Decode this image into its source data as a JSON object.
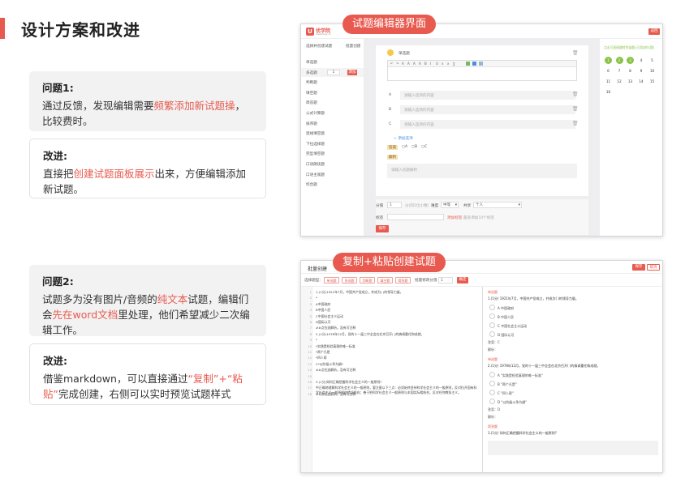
{
  "page": {
    "title": "设计方案和改进"
  },
  "problem1": {
    "heading": "问题1:",
    "text_a": "通过反馈，发现编辑需要",
    "text_hl": "频繁添加新试题操",
    "text_b": "，比较费时。"
  },
  "improve1": {
    "heading": "改进:",
    "text_a": "直接把",
    "text_hl": "创建试题面板展示",
    "text_b": "出来，方便编辑添加新试题。"
  },
  "problem2": {
    "heading": "问题2:",
    "text_a": "试题多为没有图片/音频的",
    "text_hl1": "纯文本",
    "text_b": "试题，编辑们会",
    "text_hl2": "先在word文档",
    "text_c": "里处理，他们希望减少二次编辑工作。"
  },
  "improve2": {
    "heading": "改进:",
    "text_a": "借鉴markdown，可以直接通过",
    "text_hl": "“复制”+“粘贴”",
    "text_b": "完成创建，右侧可以实时预览试题样式"
  },
  "shot1": {
    "label": "试题编辑器界面",
    "logo": "优学院",
    "logo_sub": "ulearning.cn",
    "top_btn": "返回",
    "left_header_a": "选择并创建试题",
    "left_header_b": "批量创建",
    "types": [
      "单选题",
      "多选题",
      "判断题",
      "填空题",
      "简答题",
      "公式计算题",
      "排序题",
      "连线填空题",
      "下拉选择题",
      "完型填空题",
      "口语朗读题",
      "口语主观题",
      "综合题"
    ],
    "type_count": "1",
    "type_add": "添加",
    "q_type": "单选题",
    "toolbar": [
      "↶",
      "↷",
      "A",
      "A",
      "A",
      "A",
      "B",
      "I",
      "U",
      "x",
      "x",
      "∑"
    ],
    "options": [
      {
        "label": "A",
        "placeholder": "请输入选项的内容"
      },
      {
        "label": "B",
        "placeholder": "请输入选项的内容"
      },
      {
        "label": "C",
        "placeholder": "请输入选项的内容"
      }
    ],
    "add_option": "+ 添加选项",
    "answer_label": "答案",
    "answer_opts": [
      "A",
      "B",
      "C"
    ],
    "analysis_label": "解析",
    "analysis_placeholder": "请输入答题解析",
    "score_label": "分值",
    "score_value": "1",
    "score_hint": "分(同1位小数)",
    "difficulty_label": "难度",
    "difficulty_value": "中等",
    "share_label": "共享",
    "share_value": "个人",
    "tag_label": "标签",
    "tag_hint_red": "添加标签",
    "tag_hint": "最多添加10个标签",
    "save_btn": "保存",
    "right_header": "点击可直接跳转到该题(已添加的1题)",
    "numbers": [
      "1",
      "2",
      "3",
      "4",
      "5",
      "6",
      "7",
      "8",
      "9",
      "10",
      "11",
      "12",
      "13",
      "14",
      "15",
      "16"
    ]
  },
  "shot2": {
    "label": "复制+粘贴创建试题",
    "title": "批量创建",
    "btn_save": "保存",
    "btn_cancel": "取消",
    "type_label": "选择题型:",
    "type_btns": [
      "单选题",
      "多选题",
      "判断题",
      "填空题",
      "简答题"
    ],
    "score_label": "批量修改分值",
    "score_value": "1",
    "confirm": "确定",
    "lines": [
      "1.(1分)1921年7月，中国共产党成立，并成为( )的领导力量。",
      "*",
      "A中国政府",
      "B中国人民",
      "C中国社会主义运动",
      "D国际认可",
      "##点拉选解析，没有可注释",
      "2.(1分)1978年12月，党的十一届三中全会在北京召开( )的搞调重任和成就。",
      "*",
      "*实践是检验真理的唯一标准",
      "*两个凡是",
      "*四人帮",
      "C*以阶级斗争为纲*",
      "##点拉选解析，没有可注释",
      "",
      "3.(1分)如何正确把握科学社会主义的一般原则?",
      "中正确地理解科学社会主义的一般原则，要注意以下三点：必须始终坚持科学社会主义的一般原则，反对拉开固有科学社会主义一般原则的错误倾向；善于把科学社会主义一般原则与本国实际相结合，反对任何教条主义。",
      "##点拉选解析，没有可注释"
    ],
    "preview": [
      {
        "badge": "单选题",
        "q": "1.(1分) 1921年7月，中国共产党成立，并成为( )的领导力量。",
        "opts": [
          "A  中国政府",
          "B  中国人民",
          "C  中国社会主义运动",
          "D  国际认可"
        ],
        "answer": "答案：C",
        "analysis": "解析："
      },
      {
        "badge": "单选题",
        "q": "2.(1分) 1978年12月，党的十一届三中全会在北京召开( )的搞调重任和成就。",
        "opts": [
          "A  \"实践是检验真理的唯一标准\"",
          "B  \"两个凡是\"",
          "C  \"四人帮\"",
          "D  \"以阶级斗争为纲\""
        ],
        "answer": "答案：D",
        "analysis": "解析："
      },
      {
        "badge": "简答题",
        "q": "3.(1分) 如何正确把握科学社会主义的一般原则?",
        "opts": [],
        "answer": "",
        "analysis": ""
      }
    ]
  },
  "colors": {
    "accent": "#e85a4f",
    "done": "#8bc34a"
  }
}
